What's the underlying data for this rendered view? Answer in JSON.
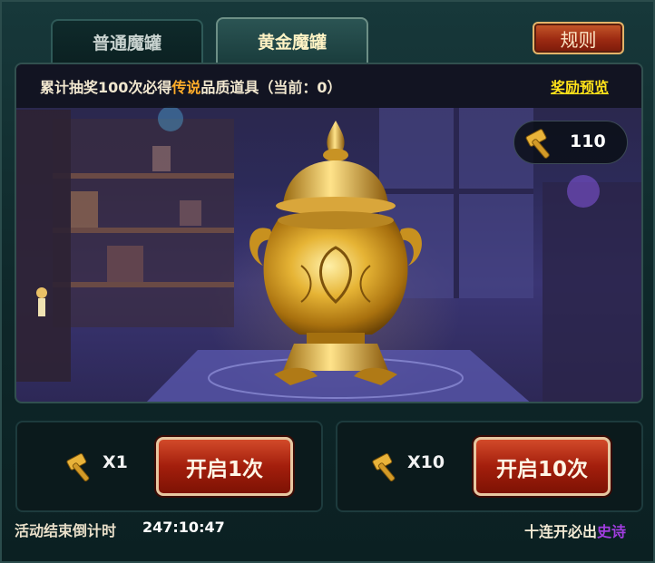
{
  "tabs": [
    {
      "label": "普通魔罐",
      "active": false
    },
    {
      "label": "黄金魔罐",
      "active": true
    }
  ],
  "rules_label": "规则",
  "info": {
    "text_before": "累计抽奖100次必得",
    "legendary": "传说",
    "text_after": "品质道具（当前：0）",
    "reward_preview_label": "奖励预览",
    "legendary_color": "#ffad2a"
  },
  "hammer": {
    "icon": "gold-hammer-icon",
    "count": "110"
  },
  "pot": {
    "icon": "golden-pot"
  },
  "draw_once": {
    "cost_label": "X1",
    "button_label": "开启1次"
  },
  "draw_ten": {
    "cost_label": "X10",
    "button_label": "开启10次"
  },
  "countdown": {
    "label": "活动结束倒计时",
    "value": "247:10:47"
  },
  "ten_pull_note": {
    "text": "十连开必出",
    "quality": "史诗",
    "quality_color": "#a23de0"
  }
}
